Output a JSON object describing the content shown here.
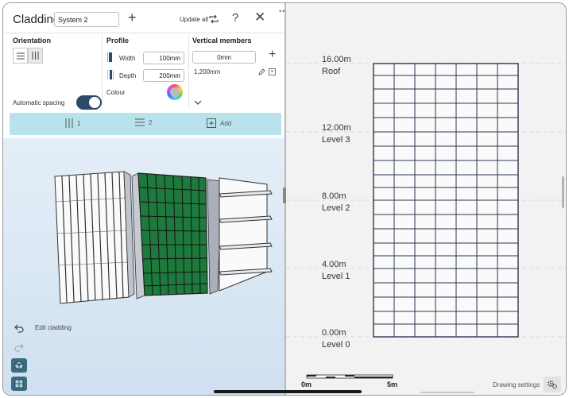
{
  "header": {
    "title": "Cladding",
    "system_name": "System 2",
    "update_all_label": "Update all",
    "icons": [
      "plus-icon",
      "sync-icon",
      "help-icon",
      "close-icon"
    ]
  },
  "orientation": {
    "heading": "Orientation",
    "selected": "vertical"
  },
  "profile": {
    "heading": "Profile",
    "width_label": "Width",
    "width_value": "100mm",
    "depth_label": "Depth",
    "depth_value": "200mm",
    "colour_label": "Colour"
  },
  "vertical_members": {
    "heading": "Vertical members",
    "input_value": "0mm",
    "items": [
      "1,200mm"
    ]
  },
  "automatic_spacing": {
    "label": "Automatic spacing",
    "on": true
  },
  "tabs": [
    {
      "count": "1",
      "icon": "vertical-lines-icon"
    },
    {
      "count": "2",
      "icon": "horizontal-lines-icon"
    },
    {
      "label": "Add",
      "icon": "add-box-icon"
    }
  ],
  "viewport": {
    "edit_label": "Edit cladding",
    "panel_colors": {
      "frame": "#ffffff",
      "grid_panel": "#1d7a3c",
      "outline": "#333333"
    }
  },
  "drawing": {
    "levels": [
      {
        "elevation": "16.00m",
        "name": "Roof"
      },
      {
        "elevation": "12.00m",
        "name": "Level 3"
      },
      {
        "elevation": "8.00m",
        "name": "Level 2"
      },
      {
        "elevation": "4.00m",
        "name": "Level 1"
      },
      {
        "elevation": "0.00m",
        "name": "Level 0"
      }
    ],
    "scale_start": "0m",
    "scale_end": "5m",
    "settings_label": "Drawing settings"
  },
  "colors": {
    "accent_bar": "#b9e3ec",
    "toggle": "#2c4a67",
    "grid_line": "#2a3550"
  }
}
